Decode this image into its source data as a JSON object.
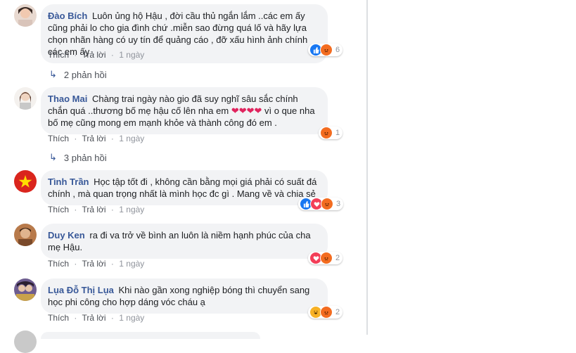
{
  "comments": [
    {
      "author": "Đào Bích",
      "text": "Luôn ủng hộ Hậu , đời cầu thủ ngắn lắm ..các em ấy cũng phải lo cho gia đình chứ .miễn sao đừng quá lố và hãy lựa chọn nhãn hàng có uy tín để quảng cáo , đỡ xấu hình ảnh chính các em ấy .",
      "like": "Thích",
      "reply": "Trả lời",
      "time": "1 ngày",
      "reaction_count": "6",
      "replies_label": "2 phản hồi"
    },
    {
      "author": "Thao Mai",
      "text_before": "Chàng trai ngày nào gio đã suy nghĩ sâu sắc chính chắn quá ..thương bố mẹ hậu cố lên nha em",
      "text_after": "vì o que nha bố mẹ cũng mong em mạnh khỏe và thành công đó em .",
      "like": "Thích",
      "reply": "Trả lời",
      "time": "1 ngày",
      "reaction_count": "1",
      "replies_label": "3 phản hồi"
    },
    {
      "author": "Tình Trần",
      "text": "Học tập tốt đi , không cần bằng mọi giá phải có suất đá chính , mà quan trọng nhất là mình học đc gì . Mang về và chia sẻ",
      "like": "Thích",
      "reply": "Trả lời",
      "time": "1 ngày",
      "reaction_count": "3"
    },
    {
      "author": "Duy Ken",
      "text": "ra đi va trở về bình an luôn là niềm hạnh phúc của cha mẹ Hậu.",
      "like": "Thích",
      "reply": "Trả lời",
      "time": "1 ngày",
      "reaction_count": "2"
    },
    {
      "author": "Lụa Đỗ Thị Lụa",
      "text": "Khi nào gần xong nghiệp bóng thì chuyển sang học phi công cho hợp dáng vóc cháu ạ",
      "like": "Thích",
      "reply": "Trả lời",
      "time": "1 ngày",
      "reaction_count": "2"
    }
  ],
  "separator": "·",
  "colors": {
    "link": "#385898",
    "bubble": "#f2f3f5",
    "like_blue": "#1877f2",
    "angry": "#f36c20",
    "love": "#f33e58"
  }
}
